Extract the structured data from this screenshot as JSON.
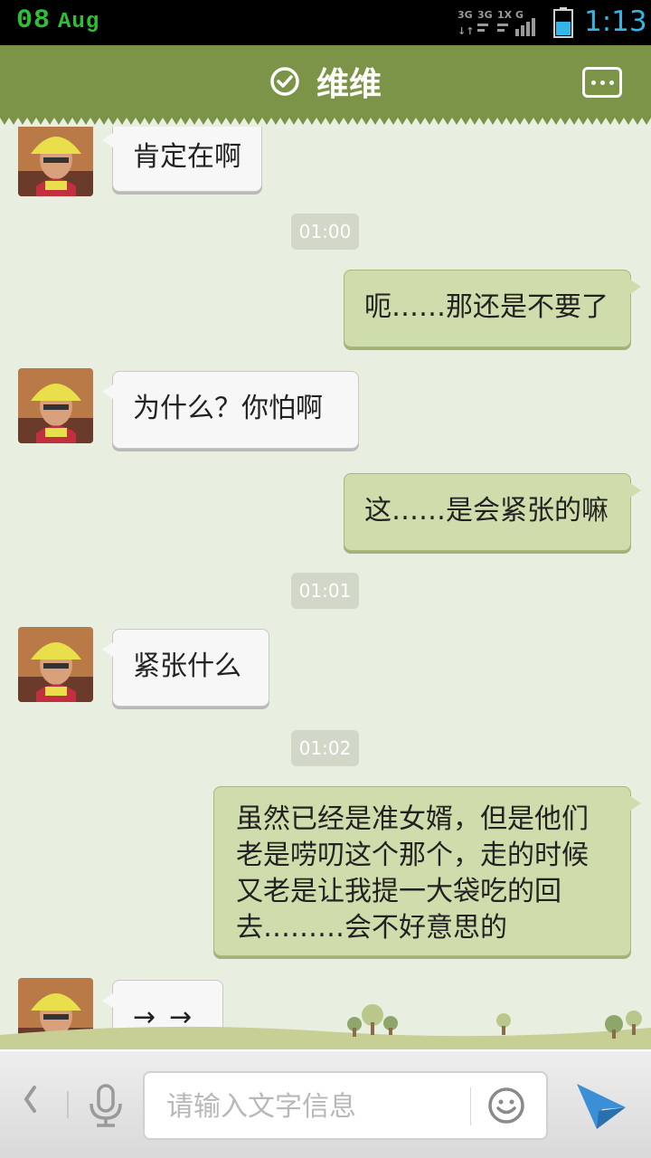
{
  "status_bar": {
    "date_day": "08",
    "date_month": "Aug",
    "time": "1:13",
    "network_icon": "signal-3g-icon",
    "battery_icon": "battery-icon",
    "time_color": "#33b5e5",
    "date_color": "#2fbf35"
  },
  "header": {
    "title": "维维",
    "status_icon": "verified-check-icon",
    "menu_icon": "more-icon",
    "color": "#7b9447"
  },
  "messages": [
    {
      "type": "in",
      "text": "肯定在啊"
    },
    {
      "type": "time",
      "text": "01:00"
    },
    {
      "type": "out",
      "text": "呃……那还是不要了"
    },
    {
      "type": "in",
      "text": "为什么？你怕啊"
    },
    {
      "type": "out",
      "text": "这……是会紧张的嘛"
    },
    {
      "type": "time",
      "text": "01:01"
    },
    {
      "type": "in",
      "text": "紧张什么"
    },
    {
      "type": "time",
      "text": "01:02"
    },
    {
      "type": "out",
      "text": "虽然已经是准女婿，但是他们老是唠叨这个那个，走的时候又老是让我提一大袋吃的回去………会不好意思的"
    },
    {
      "type": "in",
      "text": "→_→"
    }
  ],
  "input_bar": {
    "placeholder": "请输入文字信息",
    "back_icon": "chevron-left-icon",
    "voice_icon": "microphone-icon",
    "emoji_icon": "smiley-icon",
    "send_icon": "send-arrow-icon",
    "send_color": "#3a8fd6"
  }
}
